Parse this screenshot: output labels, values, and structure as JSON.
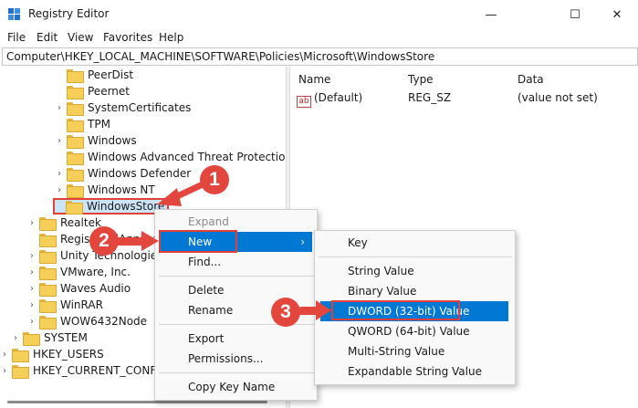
{
  "window": {
    "title": "Registry Editor",
    "minimize": "—",
    "maximize": "☐",
    "close": "✕"
  },
  "menu": [
    "File",
    "Edit",
    "View",
    "Favorites",
    "Help"
  ],
  "address": "Computer\\HKEY_LOCAL_MACHINE\\SOFTWARE\\Policies\\Microsoft\\WindowsStore",
  "tree": [
    {
      "label": "PeerDist",
      "chevron": ""
    },
    {
      "label": "Peernet",
      "chevron": ""
    },
    {
      "label": "SystemCertificates",
      "chevron": "›"
    },
    {
      "label": "TPM",
      "chevron": ""
    },
    {
      "label": "Windows",
      "chevron": "›"
    },
    {
      "label": "Windows Advanced Threat Protection",
      "chevron": ""
    },
    {
      "label": "Windows Defender",
      "chevron": "›"
    },
    {
      "label": "Windows NT",
      "chevron": "›"
    },
    {
      "label": "WindowsStore",
      "chevron": ""
    },
    {
      "label": "Realtek",
      "chevron": "›"
    },
    {
      "label": "RegisteredApplications",
      "chevron": ""
    },
    {
      "label": "Unity Technologies",
      "chevron": "›"
    },
    {
      "label": "VMware, Inc.",
      "chevron": "›"
    },
    {
      "label": "Waves Audio",
      "chevron": "›"
    },
    {
      "label": "WinRAR",
      "chevron": "›"
    },
    {
      "label": "WOW6432Node",
      "chevron": "›"
    },
    {
      "label": "SYSTEM",
      "chevron": "›"
    },
    {
      "label": "HKEY_USERS",
      "chevron": "›"
    },
    {
      "label": "HKEY_CURRENT_CONFIG",
      "chevron": "›"
    }
  ],
  "list": {
    "headers": {
      "name": "Name",
      "type": "Type",
      "data": "Data"
    },
    "rows": [
      {
        "icon": "ab",
        "name": "(Default)",
        "type": "REG_SZ",
        "data": "(value not set)"
      }
    ]
  },
  "context_menu": {
    "items": [
      "Expand",
      "New",
      "Find...",
      "Delete",
      "Rename",
      "Export",
      "Permissions...",
      "Copy Key Name"
    ],
    "submenu_arrow": "›"
  },
  "submenu": {
    "items": [
      "Key",
      "String Value",
      "Binary Value",
      "DWORD (32-bit) Value",
      "QWORD (64-bit) Value",
      "Multi-String Value",
      "Expandable String Value"
    ]
  },
  "steps": [
    "1",
    "2",
    "3"
  ],
  "colors": {
    "accent": "#0078d4",
    "annotation": "#e3463d",
    "selection": "#cce4f7"
  }
}
